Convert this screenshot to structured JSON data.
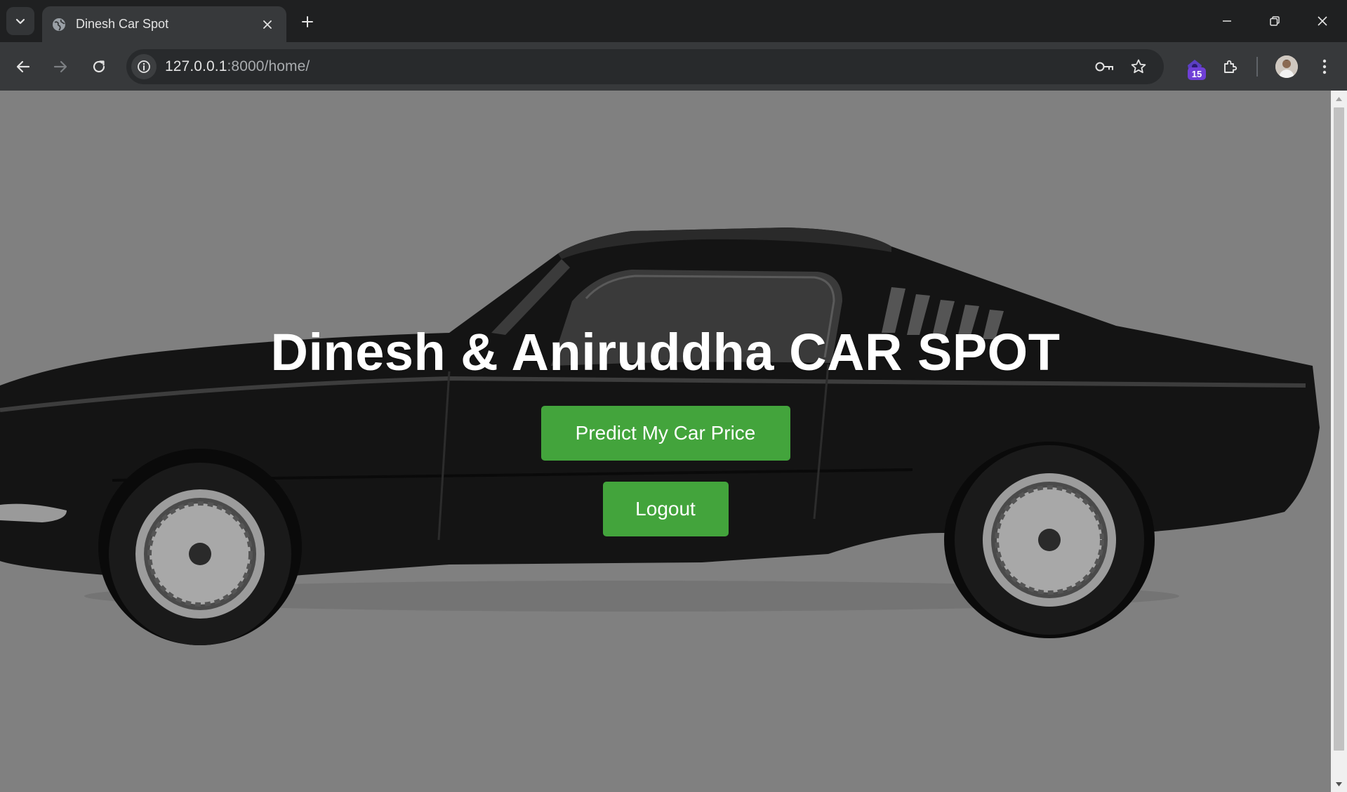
{
  "browser": {
    "tab_title": "Dinesh Car Spot",
    "url_host": "127.0.0.1",
    "url_rest": ":8000/home/",
    "extension_badge": "15"
  },
  "page": {
    "title": "Dinesh & Aniruddha CAR SPOT",
    "predict_button": "Predict My Car Price",
    "logout_button": "Logout"
  },
  "colors": {
    "page_background": "#808080",
    "button_green": "#43a43c",
    "title_text": "#ffffff",
    "car_body": "#151515"
  }
}
